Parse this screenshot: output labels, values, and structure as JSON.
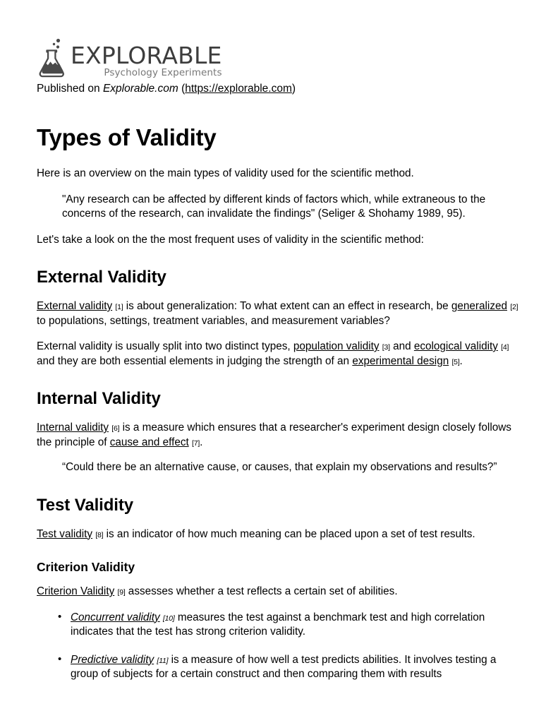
{
  "logo": {
    "mark": "flask-icon",
    "wordmark": "EXPLORABLE",
    "tagline": "Psychology Experiments",
    "wordmark_color": "#3d3d3d",
    "tagline_color": "#777777"
  },
  "published": {
    "prefix": "Published on ",
    "site": "Explorable.com",
    "open_paren": " (",
    "url": "https://explorable.com",
    "close_paren": ")"
  },
  "title": "Types of Validity",
  "intro": "Here is an overview on the main types of validity used for the scientific method.",
  "quote_seliger": "\"Any research can be affected by different kinds of factors which, while extraneous to the concerns of the research, can invalidate the findings\" (Seliger & Shohamy 1989, 95).",
  "lead_in": "Let's take a look on the the most frequent uses of validity in the scientific method:",
  "sections": {
    "external": {
      "heading": "External Validity",
      "p1": {
        "link1": "External validity",
        "ref1": "[1]",
        "mid": " is about generalization: To what extent can an effect in research, be ",
        "link2": "generalized",
        "ref2": "[2]",
        "tail": " to populations, settings, treatment variables, and measurement variables?"
      },
      "p2": {
        "start": "External validity is usually split into two distinct types, ",
        "link1": "population validity",
        "ref1": "[3]",
        "mid1": " and ",
        "link2": "ecological validity",
        "ref2": "[4]",
        "mid2": " and they are both essential elements in judging the strength of an ",
        "link3": "experimental design",
        "ref3": "[5]",
        "tail": "."
      }
    },
    "internal": {
      "heading": "Internal Validity",
      "p1": {
        "link1": "Internal validity",
        "ref1": "[6]",
        "mid": " is a measure which ensures that a researcher's experiment design closely follows the principle of ",
        "link2": "cause and effect",
        "ref2": "[7]",
        "tail": "."
      },
      "quote": "“Could there be an alternative cause, or causes, that explain my observations and results?”"
    },
    "test": {
      "heading": "Test Validity",
      "p1": {
        "link1": "Test validity",
        "ref1": "[8]",
        "tail": " is an indicator of how much meaning can be placed upon a set of test results."
      },
      "criterion": {
        "heading": "Criterion Validity",
        "p1": {
          "link1": "Criterion Validity",
          "ref1": "[9]",
          "tail": " assesses whether a test reflects a certain set of abilities."
        },
        "bullets": [
          {
            "link": "Concurrent validity",
            "ref": "[10]",
            "text": " measures the test against a benchmark test and high correlation indicates that the test has strong criterion validity."
          },
          {
            "link": "Predictive validity",
            "ref": "[11]",
            "text": " is a measure of how well a test predicts abilities. It involves testing a group of subjects for a certain construct and then comparing them with results"
          }
        ]
      }
    }
  }
}
